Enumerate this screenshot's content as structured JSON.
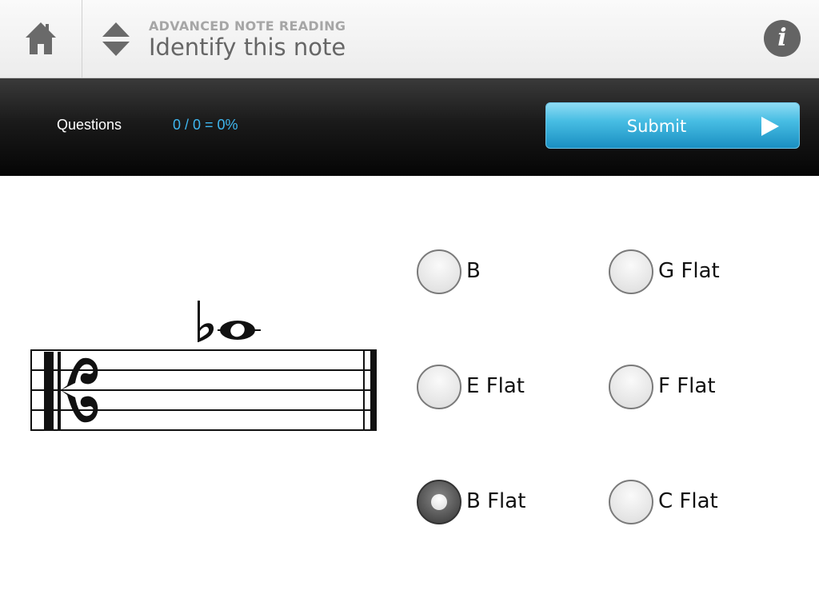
{
  "header": {
    "subtitle": "ADVANCED NOTE READING",
    "title": "Identify this note",
    "info_glyph": "i"
  },
  "scorebar": {
    "questions_label": "Questions",
    "score": "0 / 0 = 0%",
    "submit_label": "Submit"
  },
  "options": [
    {
      "label": "B",
      "selected": false
    },
    {
      "label": "G Flat",
      "selected": false
    },
    {
      "label": "E Flat",
      "selected": false
    },
    {
      "label": "F Flat",
      "selected": false
    },
    {
      "label": "B Flat",
      "selected": true
    },
    {
      "label": "C Flat",
      "selected": false
    }
  ],
  "colors": {
    "accent": "#3fb7f0",
    "submit": "#2aa3d6",
    "header_text": "#666666"
  }
}
